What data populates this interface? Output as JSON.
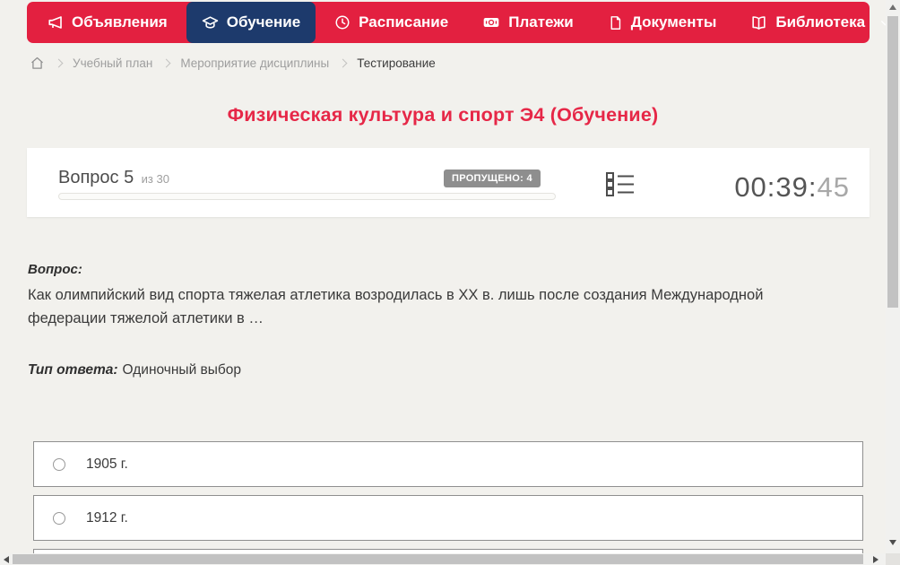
{
  "colors": {
    "nav_red": "#e32040",
    "active_navy": "#1d3a6c",
    "title_red": "#e62747",
    "badge_gray": "#8e8e8e",
    "page_bg": "#f2f1ed"
  },
  "nav": {
    "items": [
      {
        "label": "Объявления",
        "icon": "megaphone-icon",
        "active": false
      },
      {
        "label": "Обучение",
        "icon": "graduation-cap-icon",
        "active": true
      },
      {
        "label": "Расписание",
        "icon": "clock-icon",
        "active": false
      },
      {
        "label": "Платежи",
        "icon": "payments-icon",
        "active": false
      },
      {
        "label": "Документы",
        "icon": "document-icon",
        "active": false
      },
      {
        "label": "Библиотека",
        "icon": "library-book-icon",
        "active": false,
        "has_dropdown": true
      }
    ]
  },
  "breadcrumb": {
    "items": [
      "Учебный план",
      "Мероприятие дисциплины",
      "Тестирование"
    ]
  },
  "page": {
    "title": "Физическая культура и спорт Э4 (Обучение)"
  },
  "quiz": {
    "question_number": "Вопрос 5",
    "question_of_total": "из 30",
    "skipped_badge": "ПРОПУЩЕНО: 4",
    "timer_hhmm": "00:39:",
    "timer_ss": "45"
  },
  "question": {
    "heading": "Вопрос:",
    "text": "Как олимпийский вид спорта тяжелая атлетика возродилась в XX в. лишь после создания Международной федерации тяжелой атлетики в …",
    "type_label": "Тип ответа:",
    "type_value": "Одиночный выбор"
  },
  "options": [
    "1905 г.",
    "1912 г."
  ]
}
